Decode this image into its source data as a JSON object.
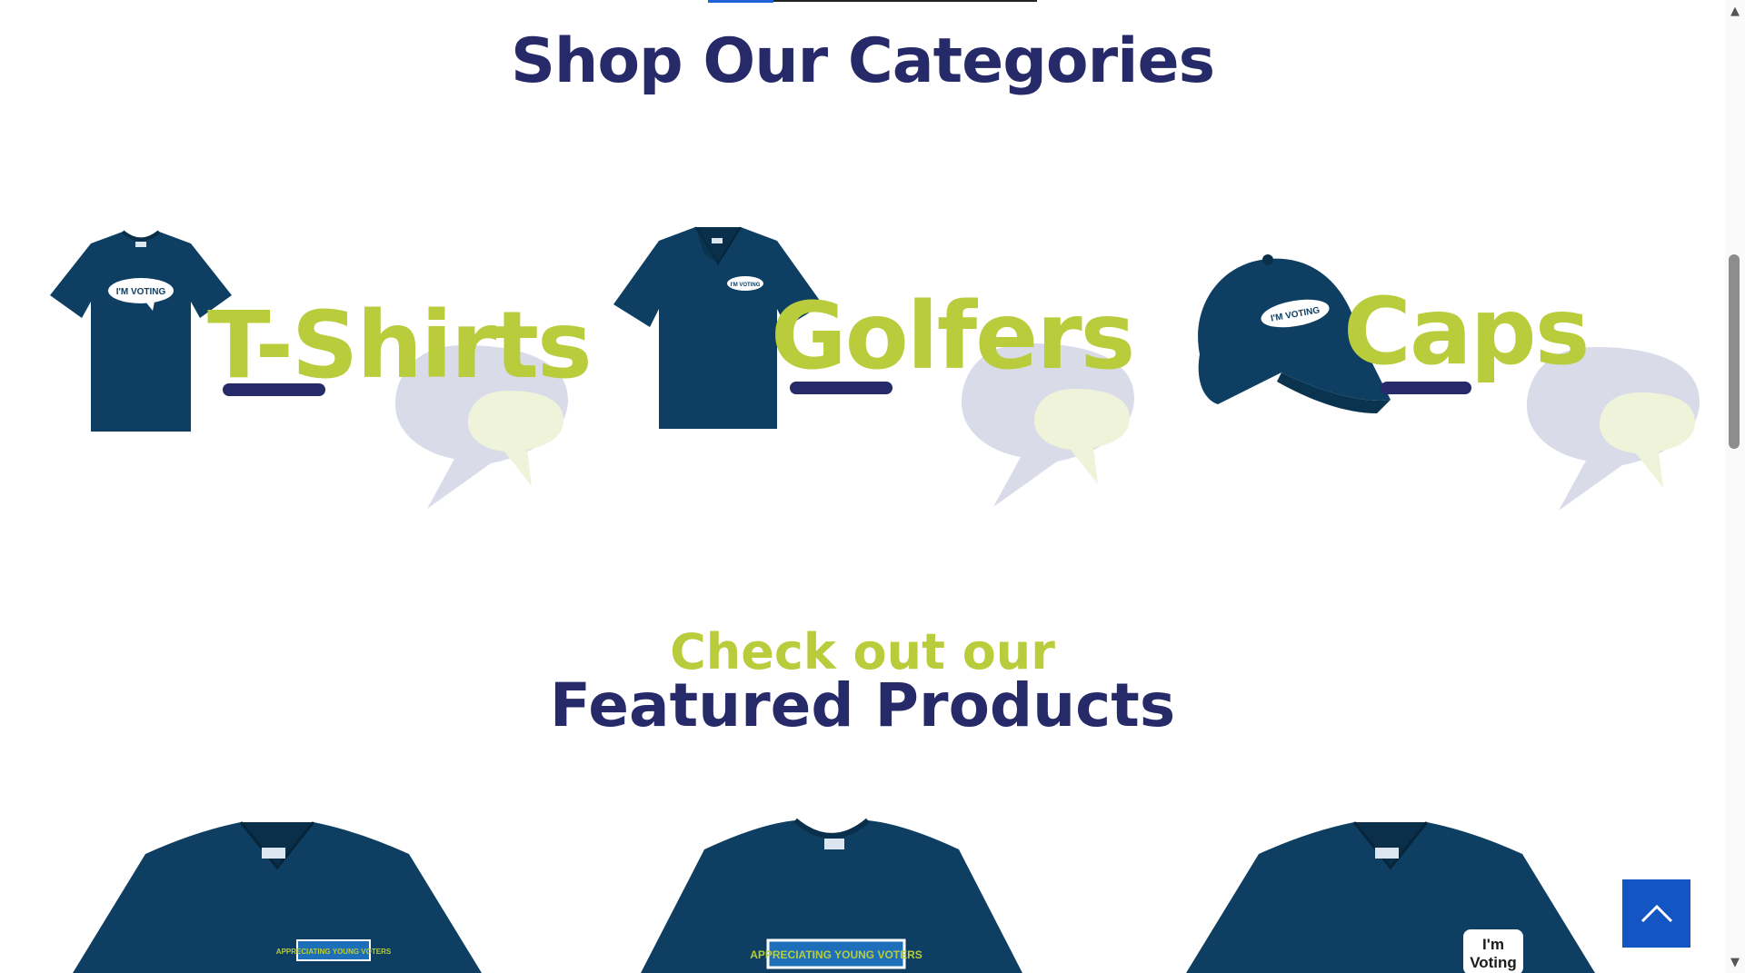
{
  "categories_section": {
    "title": "Shop Our Categories",
    "items": [
      {
        "label": "T-Shirts",
        "print": "I'M VOTING"
      },
      {
        "label": "Golfers",
        "print": "I'M VOTING"
      },
      {
        "label": "Caps",
        "print": "I'M VOTING"
      }
    ]
  },
  "featured_section": {
    "subtitle": "Check out our",
    "title": "Featured Products",
    "products": [
      {
        "print": "APPRECIATING YOUNG VOTERS"
      },
      {
        "print": "APPRECIATING YOUNG VOTERS"
      },
      {
        "print_line1": "I'm",
        "print_line2": "Voting"
      }
    ]
  },
  "colors": {
    "navy": "#262a69",
    "lime": "#b8cc3c",
    "product_navy": "#0e3f63",
    "accent_blue": "#1355c2"
  },
  "icons": {
    "back_to_top": "chevron-up-icon",
    "scroll_up": "triangle-up-icon",
    "scroll_down": "triangle-down-icon"
  }
}
